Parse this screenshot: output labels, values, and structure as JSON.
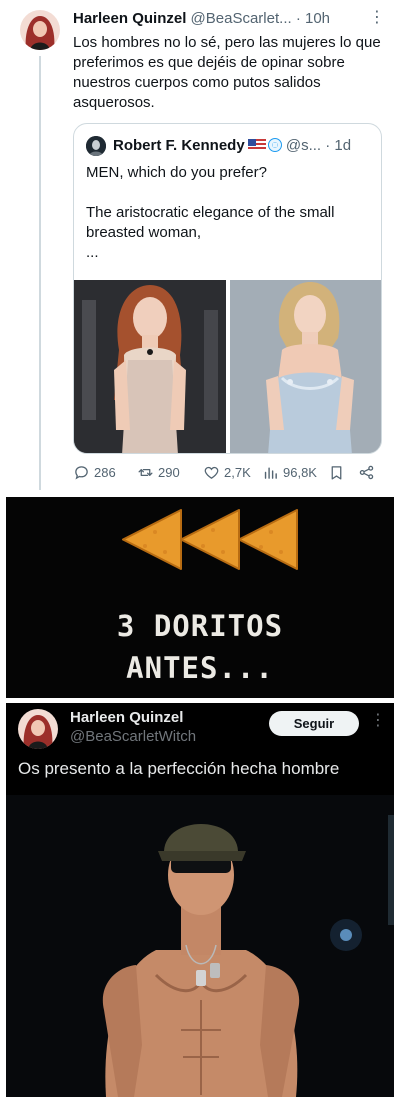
{
  "tweet1": {
    "author_name": "Harleen Quinzel",
    "author_handle": "@BeaScarlet...",
    "time": "· 10h",
    "text": "Los hombres no lo sé, pero las mujeres lo que preferimos es que dejéis de opinar sobre nuestros cuerpos como putos salidos asquerosos.",
    "more_icon": "more-vertical-icon",
    "quote": {
      "author_name": "Robert F. Kennedy",
      "author_handle": "@s...",
      "time": "· 1d",
      "badges": [
        "us-flag-icon",
        "globe-icon"
      ],
      "text": "MEN, which do you prefer?\n\nThe aristocratic elegance of the small breasted woman,\n...",
      "images": [
        "photo-woman-silver-dress",
        "photo-woman-blue-dress"
      ]
    },
    "actions": {
      "replies": "286",
      "reposts": "290",
      "likes": "2,7K",
      "views": "96,8K"
    }
  },
  "meme": {
    "line1": "3 DORITOS",
    "line2": "ANTES...",
    "chip_color": "#e89a2c"
  },
  "tweet2": {
    "author_name": "Harleen Quinzel",
    "author_handle": "@BeaScarletWitch",
    "follow_label": "Seguir",
    "text": "Os presento a la perfección hecha hombre",
    "image": "photo-shirtless-man-cap"
  },
  "colors": {
    "accent": "#1d9bf0",
    "muted": "#536471",
    "dark_bg": "#000000"
  }
}
